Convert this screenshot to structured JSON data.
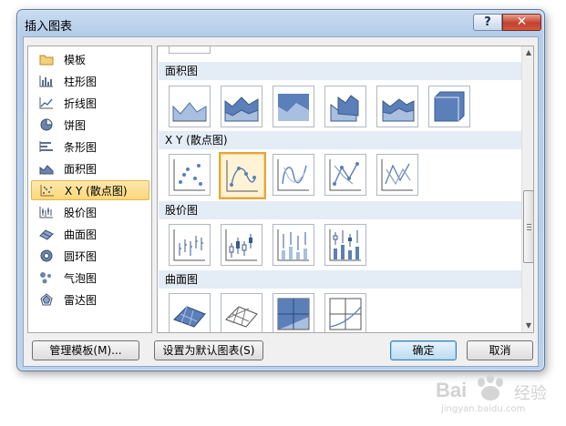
{
  "window": {
    "title": "插入图表",
    "help_label": "?",
    "close_label": "✕"
  },
  "left_panel": {
    "items": [
      {
        "label": "模板",
        "icon": "folder-icon"
      },
      {
        "label": "柱形图",
        "icon": "column-chart-icon"
      },
      {
        "label": "折线图",
        "icon": "line-chart-icon"
      },
      {
        "label": "饼图",
        "icon": "pie-chart-icon"
      },
      {
        "label": "条形图",
        "icon": "bar-chart-icon"
      },
      {
        "label": "面积图",
        "icon": "area-chart-icon"
      },
      {
        "label": "X Y (散点图)",
        "icon": "scatter-chart-icon",
        "selected": true
      },
      {
        "label": "股价图",
        "icon": "stock-chart-icon"
      },
      {
        "label": "曲面图",
        "icon": "surface-chart-icon"
      },
      {
        "label": "圆环图",
        "icon": "doughnut-chart-icon"
      },
      {
        "label": "气泡图",
        "icon": "bubble-chart-icon"
      },
      {
        "label": "雷达图",
        "icon": "radar-chart-icon"
      }
    ]
  },
  "sections": {
    "area": {
      "label": "面积图"
    },
    "scatter": {
      "label": "X Y (散点图)"
    },
    "stock": {
      "label": "股价图"
    },
    "surface": {
      "label": "曲面图"
    }
  },
  "buttons": {
    "manage_templates": "管理模板(M)...",
    "set_default": "设置为默认图表(S)",
    "ok": "确定",
    "cancel": "取消"
  },
  "watermark": {
    "brand": "Bai",
    "suffix": "经验",
    "url": "jingyan.baidu.com"
  },
  "colors": {
    "accent_selected": "#fbd77b",
    "section_header": "#e4ecf6",
    "chart_blue": "#5b7fb8"
  }
}
